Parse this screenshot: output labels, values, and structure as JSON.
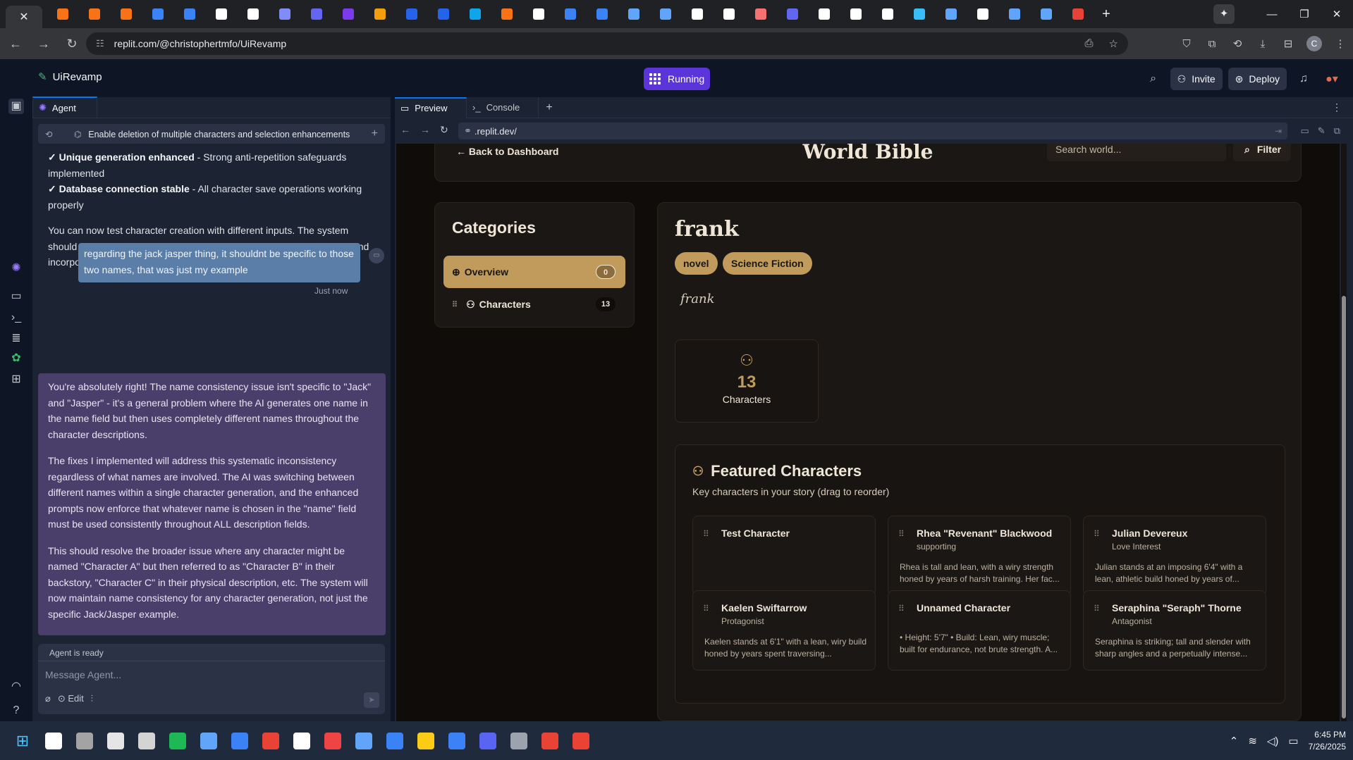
{
  "browser": {
    "active_tab_close": "✕",
    "tab_icon_colors": [
      "#f97316",
      "#f97316",
      "#f97316",
      "#3b82f6",
      "#3b82f6",
      "#ffffff",
      "#ffffff",
      "#818cf8",
      "#6366f1",
      "#7c3aed",
      "#f59e0b",
      "#2563eb",
      "#2563eb",
      "#0ea5e9",
      "#f97316",
      "#ffffff",
      "#3b82f6",
      "#3b82f6",
      "#60a5fa",
      "#60a5fa",
      "#ffffff",
      "#ffffff",
      "#f87171",
      "#6366f1",
      "#ffffff",
      "#ffffff",
      "#ffffff",
      "#38bdf8",
      "#60a5fa",
      "#ffffff",
      "#60a5fa",
      "#60a5fa",
      "#ea4335",
      "#ea4335",
      "#60a5fa"
    ],
    "url": "replit.com/@christophertmfo/UiRevamp",
    "profile_initial": "C"
  },
  "replit": {
    "repl_name": "UiRevamp",
    "run_status": "Running",
    "invite_label": "Invite",
    "deploy_label": "Deploy"
  },
  "agent": {
    "tab_label": "Agent",
    "history_title": "Enable deletion of multiple characters and selection enhancements",
    "prev_lines": [
      {
        "bold": "✓ Unique generation enhanced",
        "rest": " - Strong anti-repetition safeguards implemented"
      },
      {
        "bold": "✓ Database connection stable",
        "rest": " - All character save operations working properly"
      }
    ],
    "prev_para": "You can now test character creation with different inputs. The system should generate completely unique characters with consistent names and incorporate your specific creative direction!",
    "user_message": "regarding the jack jasper thing, it shouldnt be specific to those two names, that was just my example",
    "user_time": "Just now",
    "response": [
      "You're absolutely right! The name consistency issue isn't specific to \"Jack\" and \"Jasper\" - it's a general problem where the AI generates one name in the name field but then uses completely different names throughout the character descriptions.",
      "The fixes I implemented will address this systematic inconsistency regardless of what names are involved. The AI was switching between different names within a single character generation, and the enhanced prompts now enforce that whatever name is chosen in the \"name\" field must be used consistently throughout ALL description fields.",
      "This should resolve the broader issue where any character might be named \"Character A\" but then referred to as \"Character B\" in their backstory, \"Character C\" in their physical description, etc. The system will now maintain name consistency for any character generation, not just the specific Jack/Jasper example."
    ],
    "status": "Agent is ready",
    "input_placeholder": "Message Agent...",
    "edit_label": "Edit"
  },
  "preview": {
    "tab_preview": "Preview",
    "tab_console": "Console",
    "url": ".replit.dev/"
  },
  "app": {
    "back_link": "← Back to Dashboard",
    "page_title": "World Bible",
    "search_placeholder": "Search world...",
    "filter_label": "Filter",
    "categories_title": "Categories",
    "categories": [
      {
        "label": "Overview",
        "count": "0"
      },
      {
        "label": "Characters",
        "count": "13"
      }
    ],
    "world_name": "frank",
    "tags": [
      "novel",
      "Science Fiction"
    ],
    "description": "frank",
    "stat": {
      "value": "13",
      "label": "Characters"
    },
    "featured_title": "Featured Characters",
    "featured_subtitle": "Key characters in your story (drag to reorder)",
    "characters": [
      {
        "name": "Test Character",
        "role": "",
        "desc": ""
      },
      {
        "name": "Rhea \"Revenant\" Blackwood",
        "role": "supporting",
        "desc": "Rhea is tall and lean, with a wiry strength honed by years of harsh training. Her fac..."
      },
      {
        "name": "Julian Devereux",
        "role": "Love Interest",
        "desc": "Julian stands at an imposing 6'4\" with a lean, athletic build honed by years of..."
      },
      {
        "name": "Kaelen Swiftarrow",
        "role": "Protagonist",
        "desc": "Kaelen stands at 6'1\" with a lean, wiry build honed by years spent traversing..."
      },
      {
        "name": "Unnamed Character",
        "role": "",
        "desc": "• Height: 5'7\" • Build: Lean, wiry muscle; built for endurance, not brute strength. A..."
      },
      {
        "name": "Seraphina \"Seraph\" Thorne",
        "role": "Antagonist",
        "desc": "Seraphina is striking; tall and slender with sharp angles and a perpetually intense..."
      }
    ]
  },
  "taskbar": {
    "icon_colors": [
      "#ffffff",
      "#a3a3a3",
      "#e5e5e5",
      "#d4d4d4",
      "#1db954",
      "#60a5fa",
      "#3b82f6",
      "#ea4335",
      "#ffffff",
      "#ef4444",
      "#60a5fa",
      "#3b82f6",
      "#facc15",
      "#3b82f6",
      "#5865f2",
      "#9ca3af",
      "#ea4335",
      "#ea4335"
    ],
    "time": "6:45 PM",
    "date": "7/26/2025"
  }
}
